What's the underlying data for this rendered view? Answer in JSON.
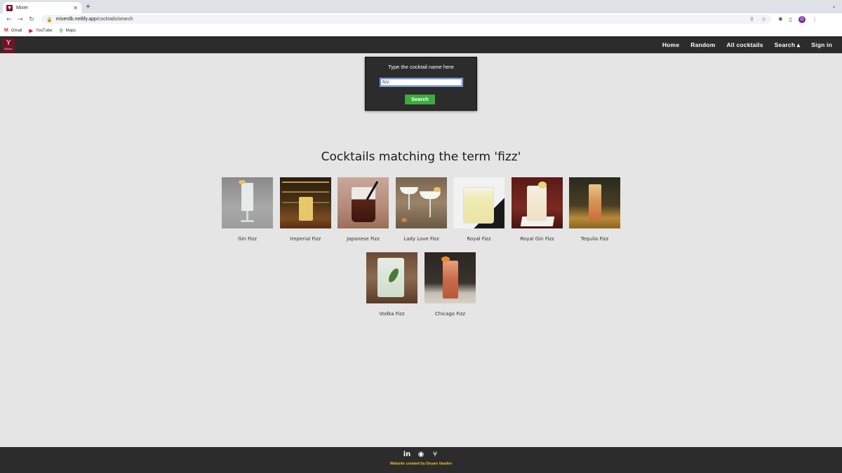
{
  "browser": {
    "tab_title": "Mixer",
    "url_host": "mixerdb.netlify.app",
    "url_path": "/cocktails/search",
    "profile_initial": "D",
    "bookmarks": [
      {
        "label": "Gmail",
        "icon": "gmail-icon"
      },
      {
        "label": "YouTube",
        "icon": "youtube-icon"
      },
      {
        "label": "Maps",
        "icon": "maps-icon"
      }
    ]
  },
  "nav": {
    "logo_text": "Mixer",
    "links": [
      "Home",
      "Random",
      "All cocktails",
      "Search ▴",
      "Sign in"
    ]
  },
  "search": {
    "label": "Type the cocktail name here",
    "value": "fizz",
    "button_label": "Search"
  },
  "results": {
    "title": "Cocktails matching the term 'fizz'",
    "items": [
      {
        "name": "Gin Fizz"
      },
      {
        "name": "Imperial Fizz"
      },
      {
        "name": "Japanese Fizz"
      },
      {
        "name": "Lady Love Fizz"
      },
      {
        "name": "Royal Fizz"
      },
      {
        "name": "Royal Gin Fizz"
      },
      {
        "name": "Tequila Fizz"
      },
      {
        "name": "Vodka Fizz"
      },
      {
        "name": "Chicago Fizz"
      }
    ]
  },
  "footer": {
    "social_icons": [
      "linkedin-icon",
      "github-icon",
      "git-icon"
    ],
    "credit": "Website created by Deyan Vasilev"
  },
  "colors": {
    "page_bg": "#e5e5e5",
    "nav_bg": "#2c2c2c",
    "search_button": "#3dab3d",
    "credit_text": "#f2c12e",
    "logo_bg": "#6e1525"
  }
}
